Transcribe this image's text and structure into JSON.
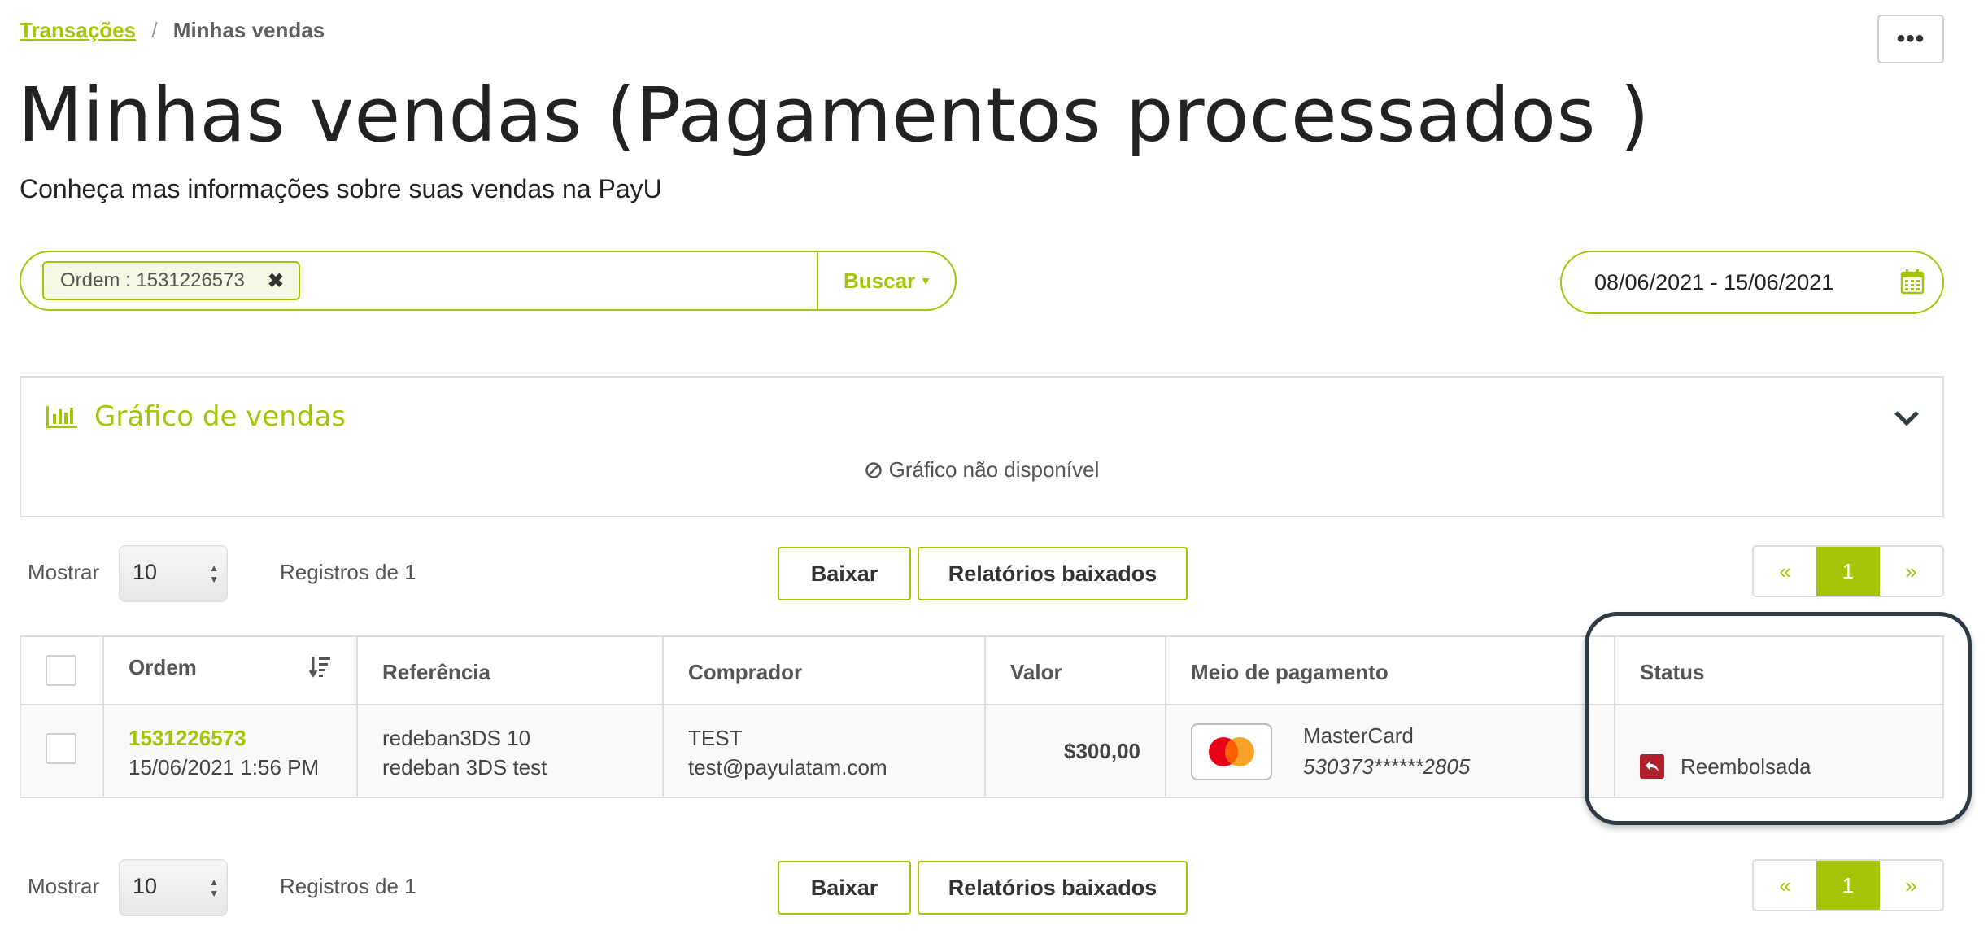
{
  "breadcrumb": {
    "parent": "Transações",
    "separator": "/",
    "current": "Minhas vendas"
  },
  "more_button": {
    "label": "•••"
  },
  "page": {
    "title": "Minhas vendas (Pagamentos processados )",
    "subtitle": "Conheça mas informações sobre suas vendas na PayU"
  },
  "search": {
    "chip_label": "Ordem : 1531226573",
    "chip_remove": "✖",
    "button_label": "Buscar"
  },
  "date_range": {
    "value": "08/06/2021 - 15/06/2021"
  },
  "chart_panel": {
    "title": "Gráfico de vendas",
    "empty_message": "Gráfico não disponível"
  },
  "controls_top": {
    "show_label": "Mostrar",
    "page_size": "10",
    "records_label": "Registros de 1",
    "download_label": "Baixar",
    "reports_label": "Relatórios baixados",
    "pager": {
      "prev": "«",
      "current": "1",
      "next": "»"
    }
  },
  "controls_bottom": {
    "show_label": "Mostrar",
    "page_size": "10",
    "records_label": "Registros de 1",
    "download_label": "Baixar",
    "reports_label": "Relatórios baixados",
    "pager": {
      "prev": "«",
      "current": "1",
      "next": "»"
    }
  },
  "table": {
    "headers": [
      "Ordem",
      "Referência",
      "Comprador",
      "Valor",
      "Meio de pagamento",
      "Status"
    ],
    "rows": [
      {
        "order_id": "1531226573",
        "order_date": "15/06/2021 1:56 PM",
        "reference_line1": "redeban3DS 10",
        "reference_line2": "redeban 3DS test",
        "buyer_name": "TEST",
        "buyer_email": "test@payulatam.com",
        "amount": "$300,00",
        "payment_brand": "MasterCard",
        "payment_number": "530373******2805",
        "status": "Reembolsada"
      }
    ]
  },
  "colors": {
    "accent": "#a6c307",
    "refund_status": "#b0202a",
    "highlight_border": "#2e3a46"
  }
}
